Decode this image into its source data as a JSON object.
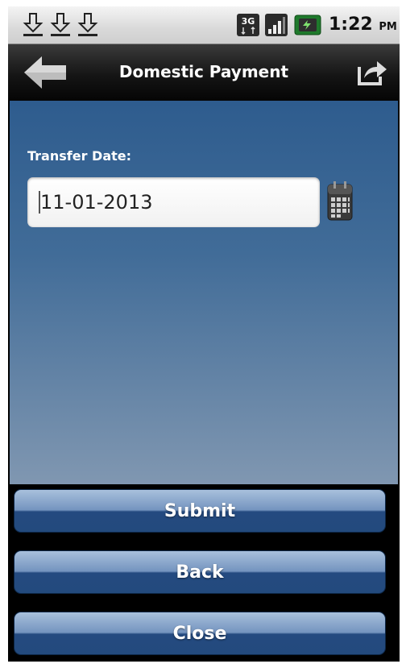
{
  "status_bar": {
    "network_label": "3G",
    "time": "1:22",
    "ampm": "PM",
    "icons": [
      "download-icon",
      "download-icon",
      "download-icon",
      "3g-icon",
      "signal-icon",
      "battery-icon"
    ]
  },
  "header": {
    "title": "Domestic Payment",
    "back_icon": "back-arrow-icon",
    "share_icon": "share-icon"
  },
  "form": {
    "transfer_label": "Transfer Date:",
    "transfer_date_value": "11-01-2013",
    "calendar_icon": "calendar-icon"
  },
  "buttons": {
    "submit_label": "Submit",
    "back_label": "Back",
    "close_label": "Close"
  },
  "colors": {
    "content_top": "#2e5c8e",
    "content_bottom": "#8097b1",
    "button_dark": "#234a7d"
  }
}
